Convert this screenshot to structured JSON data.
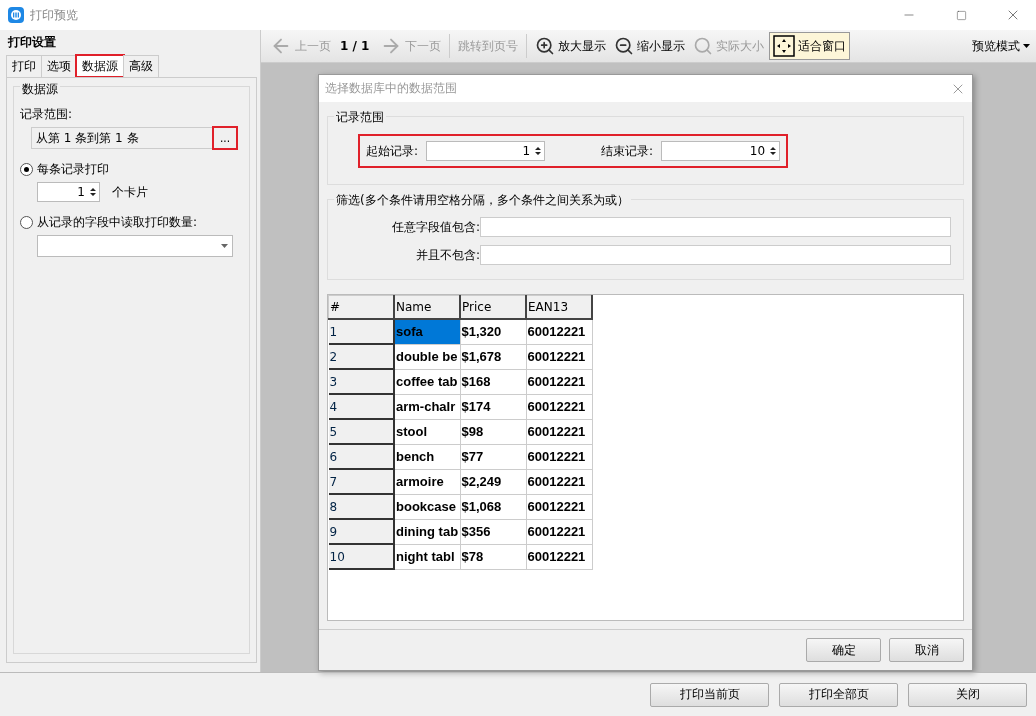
{
  "window": {
    "title": "打印预览"
  },
  "settings_panel": {
    "title": "打印设置",
    "tabs": [
      {
        "label": "打印",
        "selected": false,
        "highlighted": false
      },
      {
        "label": "选项",
        "selected": false,
        "highlighted": false
      },
      {
        "label": "数据源",
        "selected": true,
        "highlighted": true
      },
      {
        "label": "高级",
        "selected": false,
        "highlighted": false
      }
    ],
    "group_title": "数据源",
    "range_label": "记录范围:",
    "range_value": "从第 1 条到第 1 条",
    "range_button": {
      "label": "...",
      "highlighted": true
    },
    "per_record": {
      "label": "每条记录打印",
      "selected": true,
      "copies": "1",
      "unit": "个卡片"
    },
    "from_field": {
      "label": "从记录的字段中读取打印数量:",
      "selected": false
    }
  },
  "toolbar": {
    "items": [
      {
        "kind": "prev",
        "label": "上一页",
        "disabled": true
      },
      {
        "kind": "page",
        "label": "1 / 1"
      },
      {
        "kind": "next",
        "label": "下一页",
        "disabled": true
      },
      {
        "kind": "jump",
        "label": "跳转到页号",
        "disabled": true
      },
      {
        "kind": "zoom_in",
        "label": "放大显示",
        "disabled": false
      },
      {
        "kind": "zoom_out",
        "label": "缩小显示",
        "disabled": false
      },
      {
        "kind": "actual",
        "label": "实际大小",
        "disabled": true
      },
      {
        "kind": "fit",
        "label": "适合窗口",
        "disabled": false,
        "pressed": true
      }
    ],
    "mode_menu": "预览模式"
  },
  "dialog": {
    "title": "选择数据库中的数据范围",
    "range_group": {
      "title": "记录范围",
      "highlighted": true,
      "start_label": "起始记录:",
      "start_value": "1",
      "end_label": "结束记录:",
      "end_value": "10"
    },
    "filter_group": {
      "title": "筛选(多个条件请用空格分隔，多个条件之间关系为或）",
      "contains_label": "任意字段值包含:",
      "excludes_label": "并且不包含:"
    },
    "table": {
      "columns": [
        "#",
        "Name",
        "Price",
        "EAN13"
      ],
      "rows": [
        {
          "cells": [
            "1",
            "sofa",
            "$1,320",
            "60012221"
          ],
          "selected": true
        },
        {
          "cells": [
            "2",
            "double be",
            "$1,678",
            "60012221"
          ],
          "selected": false
        },
        {
          "cells": [
            "3",
            "coffee tab",
            "$168",
            "60012221"
          ],
          "selected": false
        },
        {
          "cells": [
            "4",
            "arm-chaIr",
            "$174",
            "60012221"
          ],
          "selected": false
        },
        {
          "cells": [
            "5",
            "stool",
            "$98",
            "60012221"
          ],
          "selected": false
        },
        {
          "cells": [
            "6",
            "bench",
            "$77",
            "60012221"
          ],
          "selected": false
        },
        {
          "cells": [
            "7",
            "armoire",
            "$2,249",
            "60012221"
          ],
          "selected": false
        },
        {
          "cells": [
            "8",
            "bookcase",
            "$1,068",
            "60012221"
          ],
          "selected": false
        },
        {
          "cells": [
            "9",
            "dining tab",
            "$356",
            "60012221"
          ],
          "selected": false
        },
        {
          "cells": [
            "10",
            "night tabl",
            "$78",
            "60012221"
          ],
          "selected": false
        }
      ]
    },
    "buttons": [
      "确定",
      "取消"
    ]
  },
  "footer_buttons": [
    "打印当前页",
    "打印全部页",
    "关闭"
  ]
}
